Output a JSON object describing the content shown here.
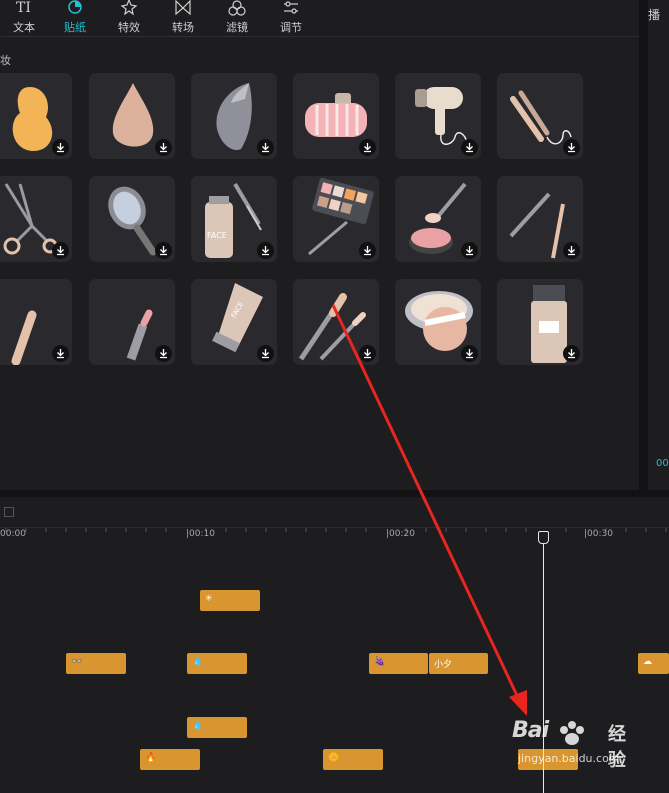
{
  "toolbar": {
    "tabs": [
      {
        "label": "文本",
        "icon": "text-icon"
      },
      {
        "label": "贴纸",
        "icon": "sticker-icon",
        "active": true
      },
      {
        "label": "特效",
        "icon": "effects-icon"
      },
      {
        "label": "转场",
        "icon": "transition-icon"
      },
      {
        "label": "滤镜",
        "icon": "filter-icon"
      },
      {
        "label": "调节",
        "icon": "adjust-icon"
      }
    ],
    "accent_color": "#1fc0d2"
  },
  "sticker_section": {
    "label": "妆",
    "items": [
      {
        "icon": "makeup-sponge-orange-icon"
      },
      {
        "icon": "makeup-sponge-beige-icon"
      },
      {
        "icon": "makeup-sponge-gray-icon"
      },
      {
        "icon": "hair-roller-icon"
      },
      {
        "icon": "hair-dryer-icon"
      },
      {
        "icon": "hair-straightener-icon"
      },
      {
        "icon": "eyelash-curler-icon"
      },
      {
        "icon": "hand-mirror-icon"
      },
      {
        "icon": "face-serum-bottle-icon",
        "text": "FACE"
      },
      {
        "icon": "eyeshadow-palette-icon"
      },
      {
        "icon": "blush-compact-icon"
      },
      {
        "icon": "eyeliner-pencils-icon"
      },
      {
        "icon": "concealer-stick-icon"
      },
      {
        "icon": "lipstick-icon"
      },
      {
        "icon": "face-cream-tube-icon",
        "text": "FACE"
      },
      {
        "icon": "makeup-brushes-icon"
      },
      {
        "icon": "powder-puff-icon"
      },
      {
        "icon": "foundation-bottle-icon"
      }
    ],
    "download_icon": "download-icon"
  },
  "preview_panel": {
    "title": "播",
    "time": "00"
  },
  "timeline": {
    "ruler_labels": [
      "00:00",
      "|00:10",
      "|00:20",
      "|00:30"
    ],
    "playhead_color": "#e8e8e8",
    "clip_color": "#d9952f",
    "clips": [
      {
        "icon": "✳"
      },
      {
        "icon": "👓"
      },
      {
        "icon": "💧"
      },
      {
        "icon": "🍇"
      },
      {
        "icon": "小夕"
      },
      {
        "icon": "☁"
      },
      {
        "icon": "💧"
      },
      {
        "icon": "🔥"
      },
      {
        "icon": "🌼"
      },
      {
        "icon": ""
      }
    ]
  },
  "annotation": {
    "arrow_color": "#e8251e"
  },
  "watermark": {
    "brand": "Bai",
    "brand_suffix": "经验",
    "site": "jingyan.baidu.com"
  }
}
